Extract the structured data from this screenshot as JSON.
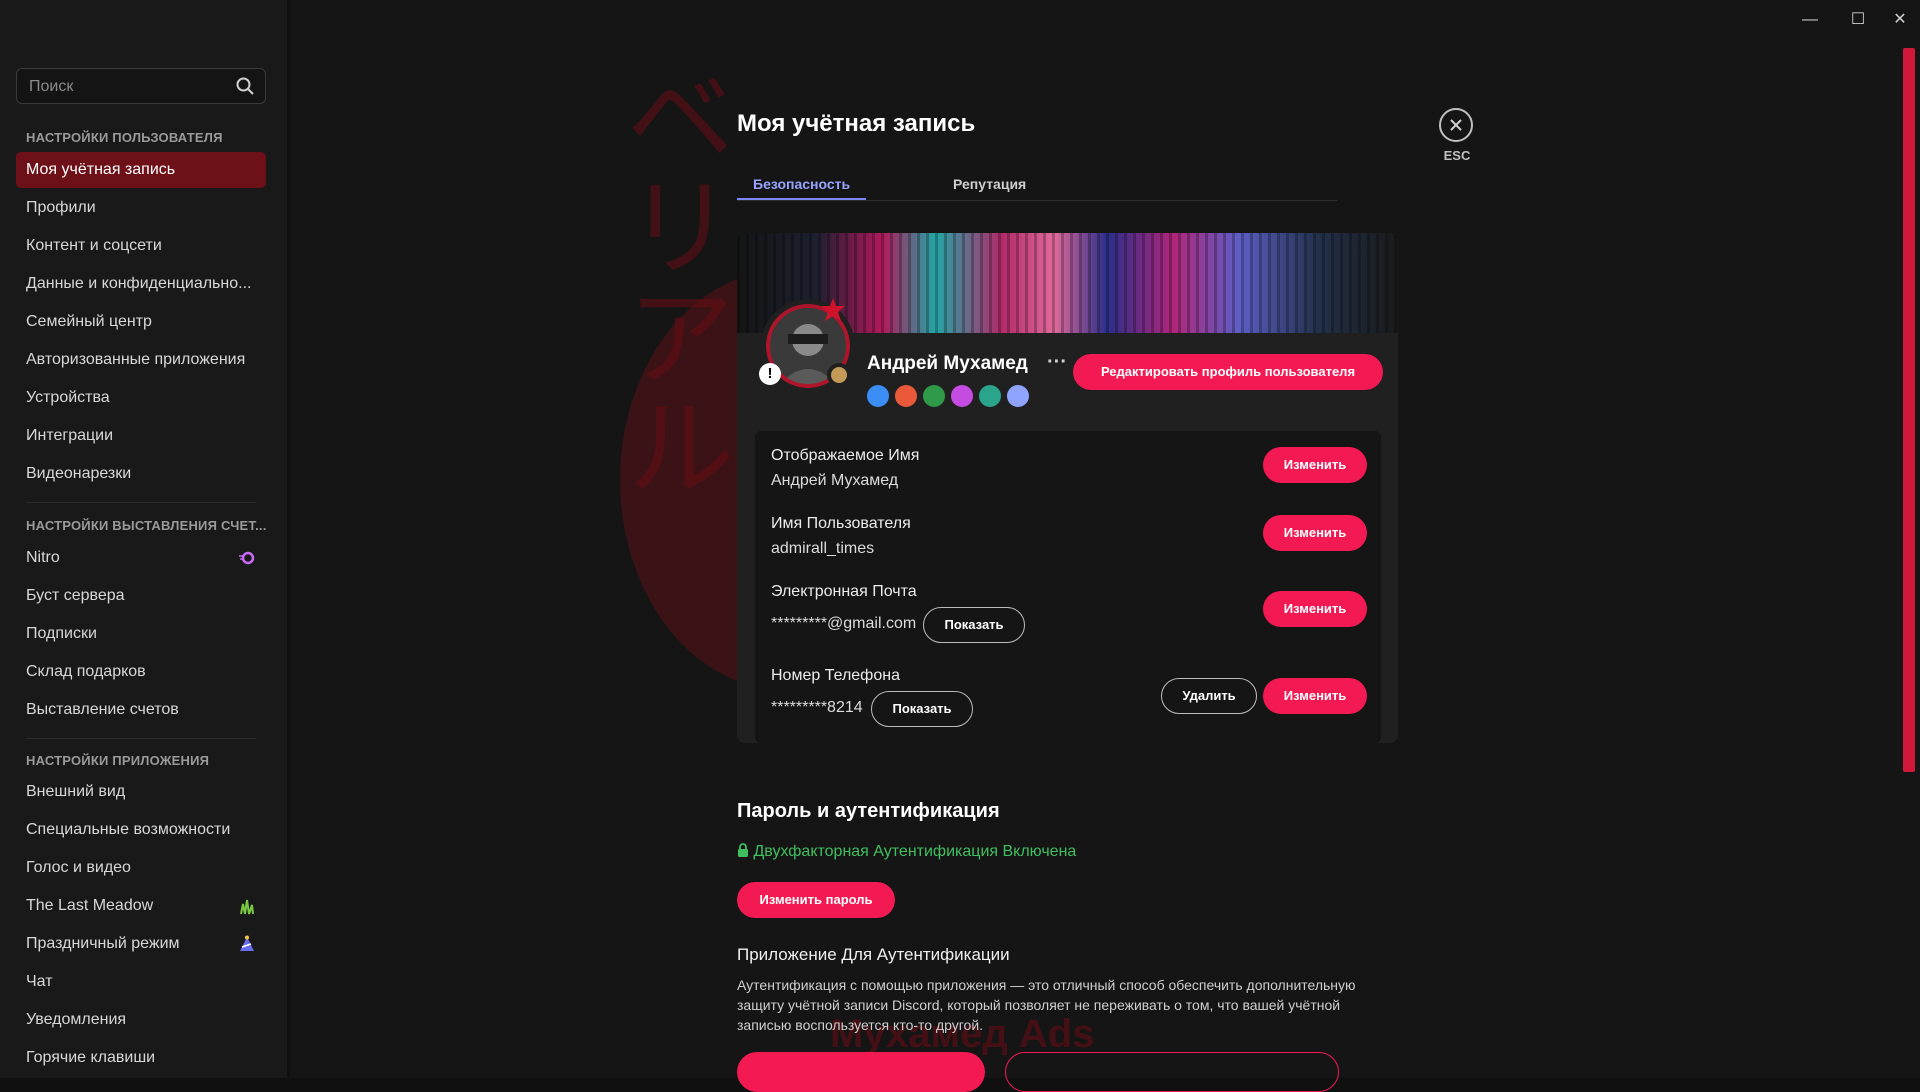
{
  "window": {
    "minimize": "—",
    "maximize": "☐",
    "close": "✕"
  },
  "sidebar": {
    "search_placeholder": "Поиск",
    "sections": {
      "user": "НАСТРОЙКИ ПОЛЬЗОВАТЕЛЯ",
      "billing": "НАСТРОЙКИ ВЫСТАВЛЕНИЯ СЧЕТ...",
      "app": "НАСТРОЙКИ ПРИЛОЖЕНИЯ"
    },
    "user_items": [
      "Моя учётная запись",
      "Профили",
      "Контент и соцсети",
      "Данные и конфиденциально...",
      "Семейный центр",
      "Авторизованные приложения",
      "Устройства",
      "Интеграции",
      "Видеонарезки"
    ],
    "billing_items": [
      "Nitro",
      "Буст сервера",
      "Подписки",
      "Склад подарков",
      "Выставление счетов"
    ],
    "app_items": [
      "Внешний вид",
      "Специальные возможности",
      "Голос и видео",
      "The Last Meadow",
      "Праздничный режим",
      "Чат",
      "Уведомления",
      "Горячие клавиши"
    ]
  },
  "main": {
    "title": "Моя учётная запись",
    "esc": "ESC",
    "tabs": [
      "Безопасность",
      "Репутация"
    ],
    "profile": {
      "name": "Андрей Мухамед",
      "more": "···",
      "edit_button": "Редактировать профиль пользователя",
      "bang": "!",
      "badges": [
        {
          "icon": "nitro-badge-icon",
          "color": "#3a8ef5"
        },
        {
          "icon": "heart-badge-icon",
          "color": "#ea5a3a"
        },
        {
          "icon": "quest-badge-icon",
          "color": "#2e9a4a"
        },
        {
          "icon": "star-badge-icon",
          "color": "#c54ce0"
        },
        {
          "icon": "hash-badge-icon",
          "color": "#2aa58c"
        },
        {
          "icon": "gear-badge-icon",
          "color": "#8fa4ff"
        }
      ]
    },
    "fields": {
      "display_name": {
        "label": "Отображаемое Имя",
        "value": "Андрей Мухамед",
        "button": "Изменить"
      },
      "username": {
        "label": "Имя Пользователя",
        "value": "admirall_times",
        "button": "Изменить"
      },
      "email": {
        "label": "Электронная Почта",
        "value": "*********@gmail.com",
        "show": "Показать",
        "button": "Изменить"
      },
      "phone": {
        "label": "Номер Телефона",
        "value": "*********8214",
        "show": "Показать",
        "delete": "Удалить",
        "button": "Изменить"
      }
    },
    "password": {
      "title": "Пароль и аутентификация",
      "twofa": "Двухфакторная Аутентификация Включена",
      "change_button": "Изменить пароль",
      "app_title": "Приложение Для Аутентификации",
      "app_desc": "Аутентификация с помощью приложения — это отличный способ обеспечить дополнительную защиту учётной записи Discord, который позволяет не переживать о том, что вашей учётной записью воспользуется кто-то другой."
    },
    "art": {
      "kana": "ベリアル",
      "watermark": "Мухамед Ads"
    },
    "colors": {
      "accent": "#f31a53",
      "active_nav": "#6e1018",
      "tab_active": "#9aa4ff",
      "success": "#3fbf5f"
    }
  }
}
